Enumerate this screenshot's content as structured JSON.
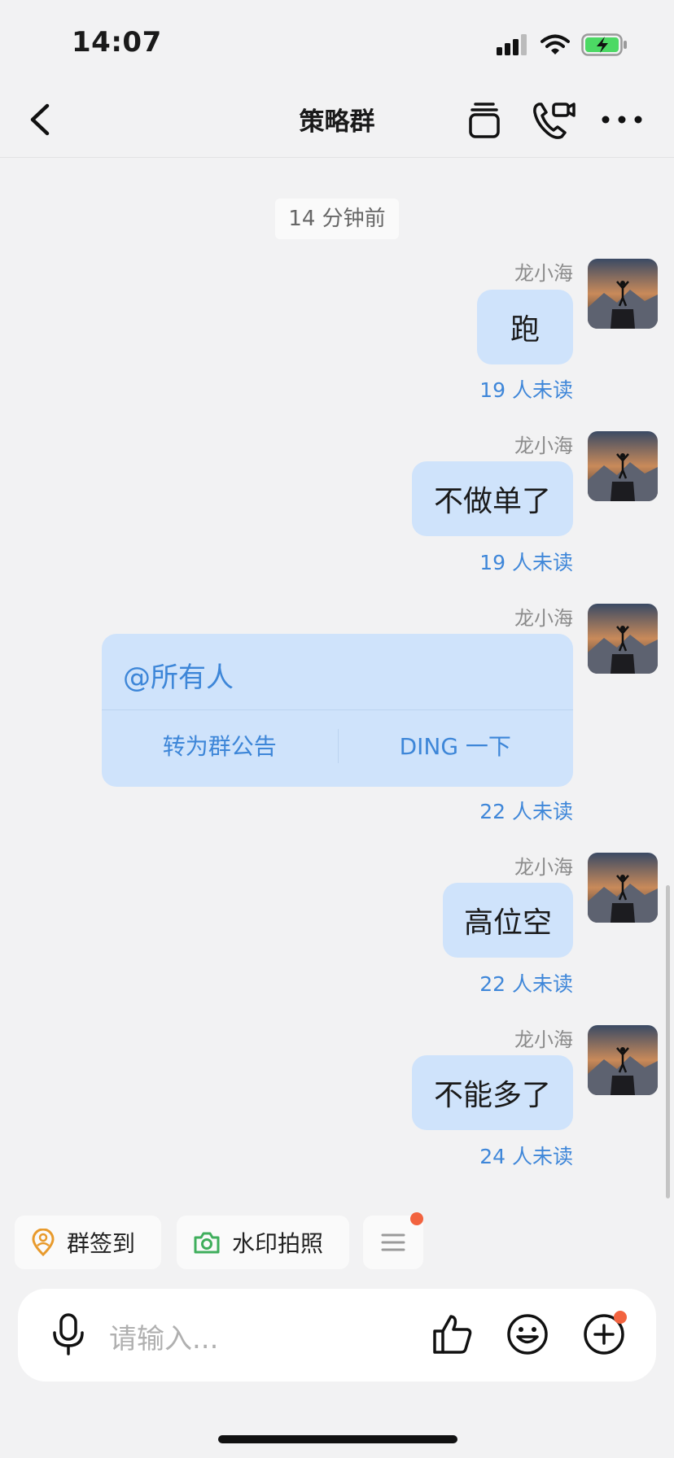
{
  "status_bar": {
    "time": "14:07"
  },
  "header": {
    "title": "策略群"
  },
  "time_divider": "14 分钟前",
  "messages": [
    {
      "sender": "龙小海",
      "text": "跑",
      "unread": "19 人未读"
    },
    {
      "sender": "龙小海",
      "text": "不做单了",
      "unread": "19 人未读"
    },
    {
      "sender": "龙小海",
      "mention": "@所有人",
      "actions": [
        "转为群公告",
        "DING 一下"
      ],
      "unread": "22 人未读"
    },
    {
      "sender": "龙小海",
      "text": "高位空",
      "unread": "22 人未读"
    },
    {
      "sender": "龙小海",
      "text": "不能多了",
      "unread": "24 人未读"
    }
  ],
  "quick_actions": [
    {
      "label": "群签到",
      "icon": "location-person-icon"
    },
    {
      "label": "水印拍照",
      "icon": "camera-icon"
    }
  ],
  "input": {
    "placeholder": "请输入..."
  },
  "colors": {
    "bubble": "#cfe3fb",
    "unread": "#3f87d9",
    "accent": "#3d86d8",
    "badge": "#f2633f"
  }
}
